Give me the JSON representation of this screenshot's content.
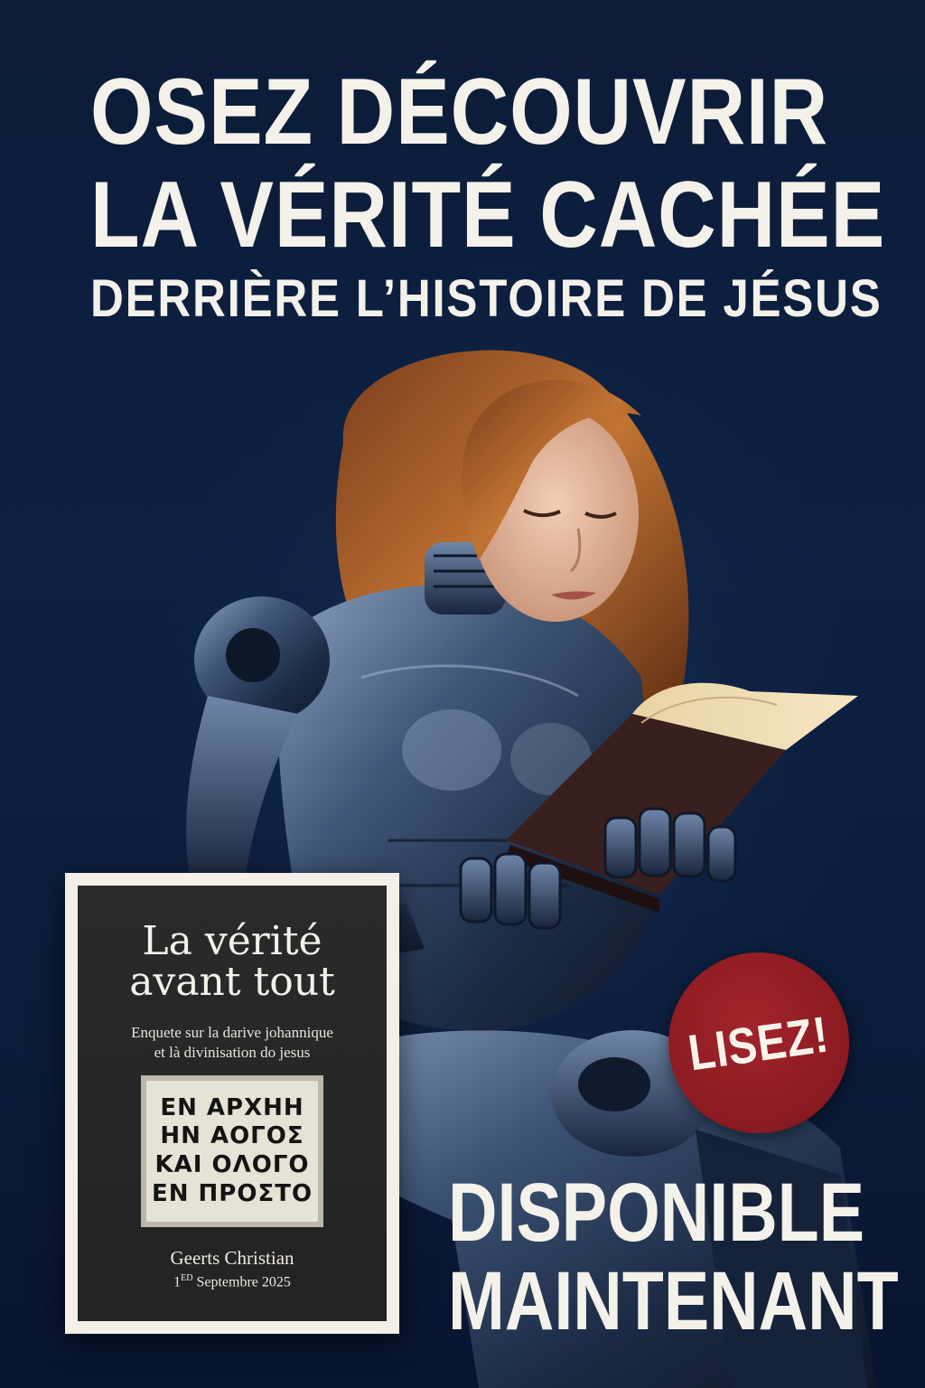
{
  "headline": {
    "line1": "OSEZ DÉCOUVRIR",
    "line2": "LA VÉRITÉ CACHÉE",
    "line3": "DERRIÈRE L’HISTOIRE DE JÉSUS"
  },
  "book": {
    "title_line1": "La vérité",
    "title_line2": "avant tout",
    "subtitle_line1": "Enquete sur la darive johannique",
    "subtitle_line2": "et là divinisation do jesus",
    "greek_lines": [
      "ΕΝ ΑΡΧΗΗ",
      "ΗΝ ΑΟΓΟΣ",
      "ΚΑΙ ΟΛΟΓΟ",
      "ΕΝ ΠΡΟΣΤΟ"
    ],
    "author": "Geerts Christian",
    "date_day": "1",
    "date_suffix": "ED",
    "date_rest": " Septembre 2025"
  },
  "badge": {
    "label": "LISEZ!",
    "color": "#8e1c22"
  },
  "availability": {
    "line1": "DISPONIBLE",
    "line2": "MAINTENANT"
  },
  "colors": {
    "background": "#0c1c38",
    "headline_text": "#f4f1ea",
    "book_frame": "#f3efe6",
    "book_cover": "#262626"
  },
  "illustration": {
    "subject": "robotic-woman-reading-book-icon"
  }
}
